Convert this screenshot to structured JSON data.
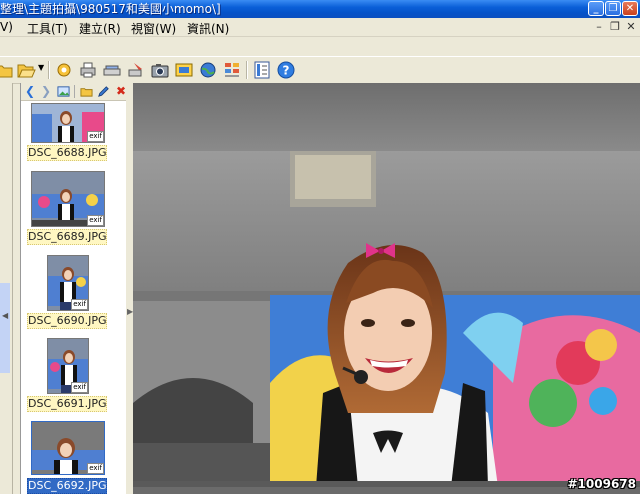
{
  "window": {
    "title": "整理\\主題拍攝\\980517和美國小momo\\]"
  },
  "menu": {
    "items": [
      {
        "label": "V)"
      },
      {
        "label": "工具(T)"
      },
      {
        "label": "建立(R)"
      },
      {
        "label": "視窗(W)"
      },
      {
        "label": "資訊(N)"
      }
    ]
  },
  "thumbnails": [
    {
      "filename": "DSC_6688.JPG",
      "selected": false,
      "badge": "exif"
    },
    {
      "filename": "DSC_6689.JPG",
      "selected": false,
      "badge": "exif"
    },
    {
      "filename": "DSC_6690.JPG",
      "selected": false,
      "badge": "exif"
    },
    {
      "filename": "DSC_6691.JPG",
      "selected": false,
      "badge": "exif"
    },
    {
      "filename": "DSC_6692.JPG",
      "selected": true,
      "badge": "exif"
    }
  ],
  "viewer": {
    "watermark": "#1009678"
  },
  "colors": {
    "titlebar": "#0a5fd8",
    "selection": "#316ac5",
    "caption_bg": "#fff7c2",
    "bow": "#e0338a"
  }
}
